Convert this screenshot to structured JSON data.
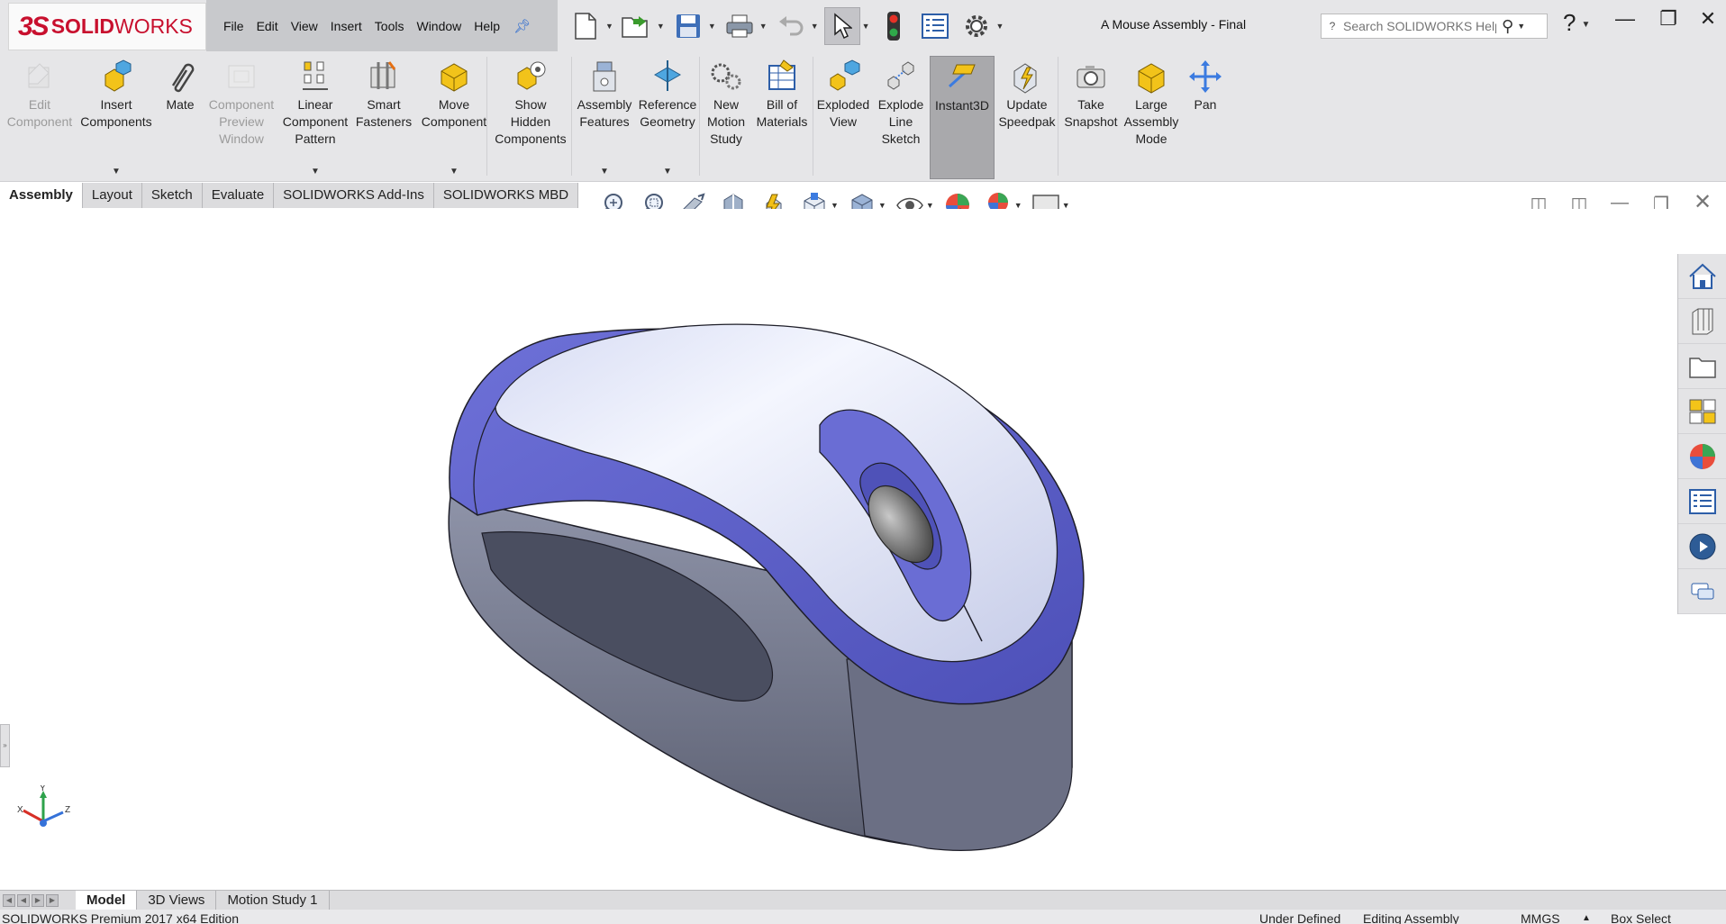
{
  "app": {
    "brand_mark": "3S",
    "brand_name_bold": "SOLID",
    "brand_name_light": "WORKS",
    "document_title": "A Mouse Assembly - Final"
  },
  "menu": {
    "items": [
      "File",
      "Edit",
      "View",
      "Insert",
      "Tools",
      "Window",
      "Help"
    ]
  },
  "search": {
    "placeholder": "Search SOLIDWORKS Help"
  },
  "ribbon": {
    "buttons": [
      {
        "label": "Edit\nComponent",
        "icon": "edit-component-icon",
        "enabled": false
      },
      {
        "label": "Insert\nComponents",
        "icon": "insert-components-icon",
        "enabled": true
      },
      {
        "label": "Mate",
        "icon": "mate-paperclip-icon",
        "enabled": true
      },
      {
        "label": "Component\nPreview\nWindow",
        "icon": "component-preview-icon",
        "enabled": false
      },
      {
        "label": "Linear\nComponent\nPattern",
        "icon": "linear-pattern-icon",
        "enabled": true
      },
      {
        "label": "Smart\nFasteners",
        "icon": "smart-fasteners-icon",
        "enabled": true
      },
      {
        "label": "Move\nComponent",
        "icon": "move-component-icon",
        "enabled": true
      },
      {
        "label": "Show\nHidden\nComponents",
        "icon": "show-hidden-icon",
        "enabled": true
      },
      {
        "label": "Assembly\nFeatures",
        "icon": "assembly-features-icon",
        "enabled": true
      },
      {
        "label": "Reference\nGeometry",
        "icon": "reference-geometry-icon",
        "enabled": true
      },
      {
        "label": "New\nMotion\nStudy",
        "icon": "motion-study-icon",
        "enabled": true
      },
      {
        "label": "Bill of\nMaterials",
        "icon": "bill-of-materials-icon",
        "enabled": true
      },
      {
        "label": "Exploded\nView",
        "icon": "exploded-view-icon",
        "enabled": true
      },
      {
        "label": "Explode\nLine\nSketch",
        "icon": "explode-line-sketch-icon",
        "enabled": true
      },
      {
        "label": "Instant3D",
        "icon": "instant3d-icon",
        "enabled": true,
        "active": true
      },
      {
        "label": "Update\nSpeedpak",
        "icon": "speedpak-icon",
        "enabled": true
      },
      {
        "label": "Take\nSnapshot",
        "icon": "camera-icon",
        "enabled": true
      },
      {
        "label": "Large\nAssembly\nMode",
        "icon": "large-assembly-icon",
        "enabled": true
      },
      {
        "label": "Pan",
        "icon": "pan-arrows-icon",
        "enabled": true
      }
    ]
  },
  "tabs": [
    "Assembly",
    "Layout",
    "Sketch",
    "Evaluate",
    "SOLIDWORKS Add-Ins",
    "SOLIDWORKS MBD"
  ],
  "bottom_tabs": [
    "Model",
    "3D Views",
    "Motion Study 1"
  ],
  "status": {
    "edition": "SOLIDWORKS Premium 2017 x64 Edition",
    "definition": "Under Defined",
    "mode": "Editing Assembly",
    "units": "MMGS",
    "select_mode": "Box Select"
  },
  "triad": {
    "x": "X",
    "y": "Y",
    "z": "Z"
  },
  "colors": {
    "model_accent": "#6f72d6",
    "model_shell": "#dde1f4",
    "model_base": "#6a6e80",
    "brand_red": "#c8102e"
  }
}
